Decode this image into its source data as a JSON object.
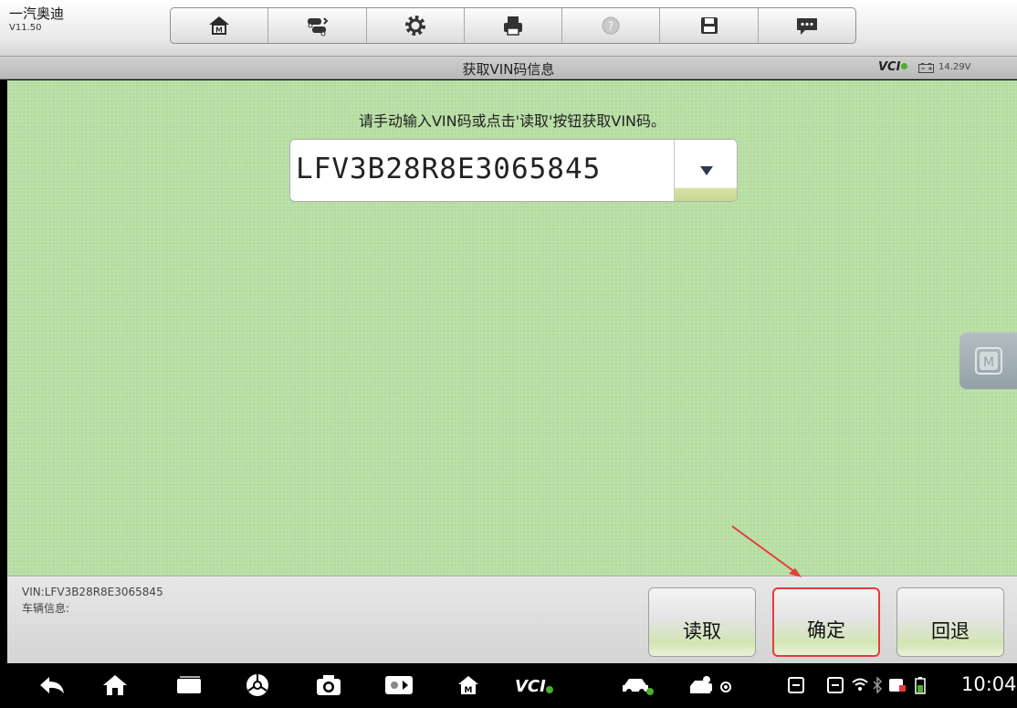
{
  "app": {
    "title": "一汽奥迪",
    "version": "V11.50"
  },
  "toolbar": {
    "buttons": [
      "home-icon",
      "vehicle-swap-icon",
      "settings-icon",
      "print-icon",
      "help-icon",
      "save-icon",
      "message-icon"
    ]
  },
  "titlebar": {
    "title": "获取VIN码信息",
    "vci_label": "VCI",
    "battery_voltage": "14.29V"
  },
  "main": {
    "instruction": "请手动输入VIN码或点击'读取'按钮获取VIN码。",
    "vin_value": "LFV3B28R8E3065845",
    "side_button_label": "M"
  },
  "bottom": {
    "vin_info": "VIN:LFV3B28R8E3065845",
    "vehicle_info": "车辆信息:",
    "read_label": "读取",
    "confirm_label": "确定",
    "back_label": "回退"
  },
  "navbar": {
    "icons": [
      "back-icon",
      "home-icon",
      "recent-apps-icon",
      "browser-icon",
      "camera-icon",
      "brightness-icon",
      "maxisys-icon",
      "vci-icon",
      "car-icon",
      "car-connect-icon",
      "screen-icon",
      "screen-icon-2",
      "wifi-icon",
      "bluetooth-icon",
      "sd-card-icon",
      "battery-icon"
    ],
    "vci_label": "VCI",
    "clock": "10:04"
  },
  "colors": {
    "main_background": "#b4dca0",
    "highlight_border": "#e53b3b",
    "vci_dot": "#4cae2d"
  }
}
